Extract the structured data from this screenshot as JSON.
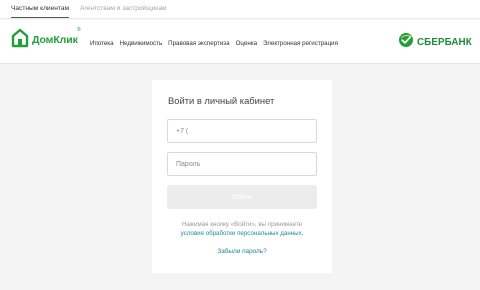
{
  "audience_tabs": {
    "private": "Частным клиентам",
    "agencies": "Агентствам и застройщикам"
  },
  "logo": {
    "text": "ДомКлик",
    "reg_mark": "®",
    "color": "#21a038"
  },
  "nav": {
    "items": [
      "Ипотека",
      "Недвижимость",
      "Правовая экспертиза",
      "Оценка",
      "Электронная регистрация"
    ]
  },
  "bank_logo": {
    "text": "СБЕРБАНК",
    "color": "#1f8a3b"
  },
  "login": {
    "title": "Войти в личный кабинет",
    "phone_placeholder": "+7 (",
    "password_placeholder": "Пароль",
    "submit_label": "Войти",
    "consent_prefix": "Нажимая кнопку «Войти», вы принимаете",
    "consent_link": "условия обработки персональных данных.",
    "forgot_link": "Забыли пароль?"
  },
  "colors": {
    "accent": "#21a038",
    "link": "#1f7fa0",
    "disabled_button": "#ececec",
    "page_background": "#f4f4f4"
  },
  "icons": {
    "logo_icon": "house-icon",
    "bank_icon": "sber-check-icon"
  }
}
